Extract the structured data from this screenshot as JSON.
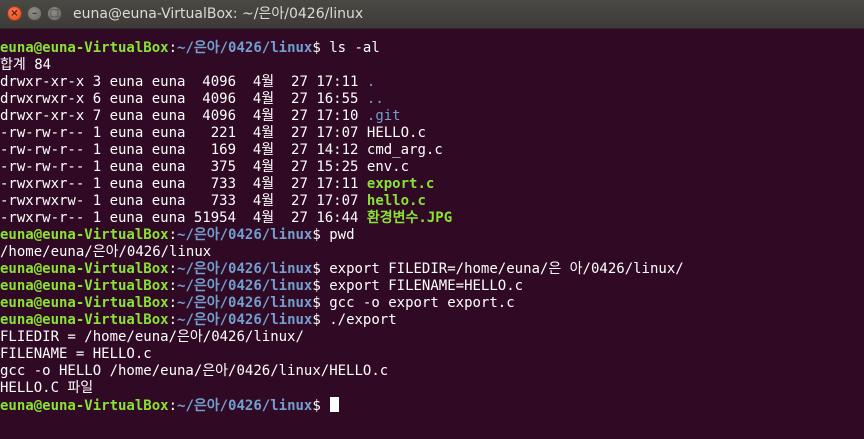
{
  "window": {
    "title": "euna@euna-VirtualBox: ~/은아/0426/linux"
  },
  "prompt": {
    "user": "euna@euna-VirtualBox",
    "path": "~/은아/0426/linux"
  },
  "terminal": {
    "cmd1": "ls -al",
    "total": "합계 84",
    "ls_rows": [
      {
        "perm": "drwxr-xr-x 3 euna euna  4096  4월  27 17:11 ",
        "name": "."
      },
      {
        "perm": "drwxrwxr-x 6 euna euna  4096  4월  27 16:55 ",
        "name": ".."
      },
      {
        "perm": "drwxr-xr-x 7 euna euna  4096  4월  27 17:10 ",
        "name": ".git"
      },
      {
        "perm": "-rw-rw-r-- 1 euna euna   221  4월  27 17:07 ",
        "name": "HELLO.c"
      },
      {
        "perm": "-rw-rw-r-- 1 euna euna   169  4월  27 14:12 ",
        "name": "cmd_arg.c"
      },
      {
        "perm": "-rw-rw-r-- 1 euna euna   375  4월  27 15:25 ",
        "name": "env.c"
      },
      {
        "perm": "-rwxrwxr-- 1 euna euna   733  4월  27 17:11 ",
        "name": "export.c"
      },
      {
        "perm": "-rwxrwxrw- 1 euna euna   733  4월  27 17:07 ",
        "name": "hello.c"
      },
      {
        "perm": "-rwxrw-r-- 1 euna euna 51954  4월  27 16:44 ",
        "name": "환경변수.JPG"
      }
    ],
    "cmd2": "pwd",
    "out_pwd": "/home/euna/은아/0426/linux",
    "cmd3": "export FILEDIR=/home/euna/은 아/0426/linux/",
    "cmd4": "export FILENAME=HELLO.c",
    "cmd5": "gcc -o export export.c",
    "cmd6": "./export",
    "out1": "FLIEDIR = /home/euna/은아/0426/linux/",
    "out2": "FILENAME = HELLO.c",
    "out3": "gcc -o HELLO /home/euna/은아/0426/linux/HELLO.c",
    "out4": "HELLO.C 파일"
  },
  "colors": {
    "background": "#300a24",
    "prompt_user": "#8ae234",
    "prompt_path": "#729fcf",
    "text": "#ffffff"
  }
}
